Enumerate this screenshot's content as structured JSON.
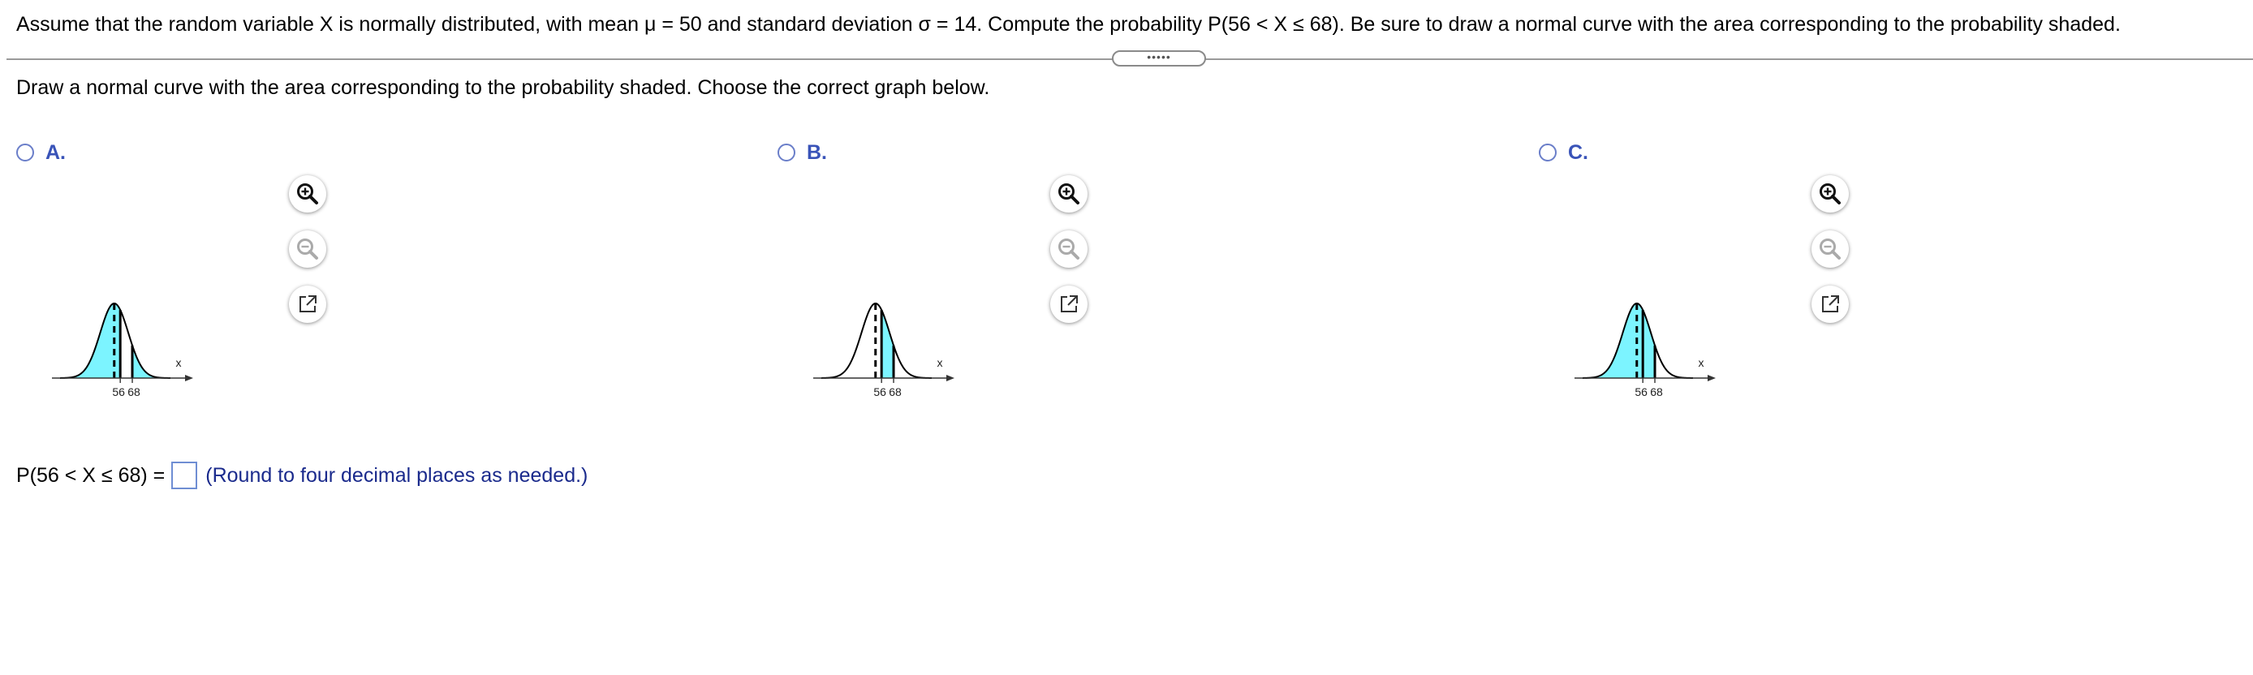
{
  "question": {
    "text": "Assume that the random variable X is normally distributed, with mean μ = 50 and standard deviation σ = 14. Compute the probability P(56 < X ≤ 68). Be sure to draw a normal curve with the area corresponding to the probability shaded."
  },
  "expand_handle": {
    "label": "•••••"
  },
  "instruction": "Draw a normal curve with the area corresponding to the probability shaded. Choose the correct graph below.",
  "options": [
    {
      "letter": "A.",
      "selected": false,
      "tick_labels": [
        "56",
        "68"
      ],
      "axis_label": "x",
      "shaded_regions": [
        [
          -4,
          56
        ],
        [
          68,
          106
        ]
      ],
      "mean_line": 50,
      "solid_lines": [
        56,
        68
      ]
    },
    {
      "letter": "B.",
      "selected": false,
      "tick_labels": [
        "56",
        "68"
      ],
      "axis_label": "x",
      "shaded_regions": [
        [
          56,
          68
        ]
      ],
      "mean_line": 50,
      "solid_lines": [
        56,
        68
      ]
    },
    {
      "letter": "C.",
      "selected": false,
      "tick_labels": [
        "56",
        "68"
      ],
      "axis_label": "x",
      "shaded_regions": [
        [
          -4,
          68
        ]
      ],
      "mean_line": 50,
      "solid_lines": [
        56,
        68
      ]
    }
  ],
  "tools": {
    "zoom_in": "zoom-in-icon",
    "zoom_out": "zoom-out-icon",
    "popout": "open-in-new-window-icon"
  },
  "colors": {
    "shade": "#7cf4ff",
    "option_letter": "#3953b8",
    "radio_border": "#6a7ec9",
    "hint": "#1a2a8c"
  },
  "answer": {
    "prompt": "P(56 < X ≤ 68) =",
    "value": "",
    "hint": "(Round to four decimal places as needed.)"
  }
}
